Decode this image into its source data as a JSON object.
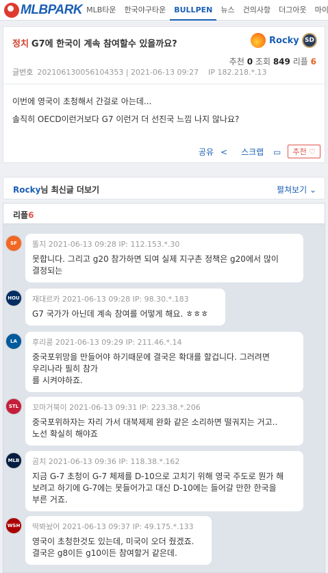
{
  "nav": {
    "logo": "MLBPARK",
    "items": [
      "MLB타운",
      "한국야구타운",
      "BULLPEN",
      "뉴스",
      "건의사항",
      "더그아웃",
      "마이"
    ]
  },
  "post": {
    "category": "정치",
    "title": "G7에 한국이 계속 참여할수 있을까요?",
    "author": "Rocky",
    "team_logo": "SD",
    "stats_rec_label": "추천",
    "stats_rec": "0",
    "stats_view_label": "조회",
    "stats_view": "849",
    "stats_reply_label": "리플",
    "stats_reply": "6",
    "meta_label": "글번호",
    "meta_text": "202106130056104353 | 2021-06-13 09:27    IP 182.218.*.13",
    "body_line1": "이번에 영국이 초청해서 간걸로 아는데...",
    "body_line2": "솔직히 OECD이런거보다 G7 이런거 더 선진국 느낌 나지 않나요?",
    "share": "공유",
    "scrap": "스크랩",
    "recommend": "추천 ♡"
  },
  "author_more": {
    "name": "Rocky",
    "suffix": "님 최신글 더보기",
    "toggle": "펼쳐보기 ⌄"
  },
  "replies": {
    "label": "리플",
    "count": "6",
    "items": [
      {
        "nick": "똘지",
        "meta": "2021-06-13 09:28 IP: 112.153.*.30",
        "text": "못합니다. 그리고 g20 참가하면 되여 실제 지구촌 정책은 g20에서 많이\n결정되는",
        "team": "SF",
        "color": "#f26722"
      },
      {
        "nick": "재대르카",
        "meta": "2021-06-13 09:28 IP: 98.30.*.183",
        "text": "G7 국가가 아닌데 계속 참여를 어떻게 해요. ㅎㅎㅎ",
        "team": "HOU",
        "color": "#002d62"
      },
      {
        "nick": "후리콩",
        "meta": "2021-06-13 09:29 IP: 211.46.*.14",
        "text": "중국포위망을 만들어야 하기때문에 결국은 확대를 할겁니다. 그러려면\n우리나라 필히 참가\n를 시켜야하죠.",
        "team": "LA",
        "color": "#005a9c"
      },
      {
        "nick": "꼬마거북이",
        "meta": "2021-06-13 09:31 IP: 223.38.*.206",
        "text": "중국포위하자는 자리 가서 대북제제 완화 같은 소리하면 떨궈지는 거고..\n노선 확실히 해야죠",
        "team": "STL",
        "color": "#c41e3a"
      },
      {
        "nick": "곰치",
        "meta": "2021-06-13 09:36 IP: 118.38.*.162",
        "text": "지금 G-7 초청이 G-7 체제를 D-10으로 고치기 위해 영국 주도로 뭔가 해\n보려고 하기에 G-7에는 못들어가고 대신 D-10에는 들어갈 만한 한국을\n부른 거죠.",
        "team": "MLB",
        "color": "#041e42"
      },
      {
        "nick": "딱봐놨어",
        "meta": "2021-06-13 09:37 IP: 49.175.*.133",
        "text": "영국이 초청한것도 있는데, 미국이 오더 줬겠죠.\n결국은 g8이든 g10이든 참여할거 같은데.",
        "team": "WSH",
        "color": "#ab0003"
      }
    ]
  }
}
